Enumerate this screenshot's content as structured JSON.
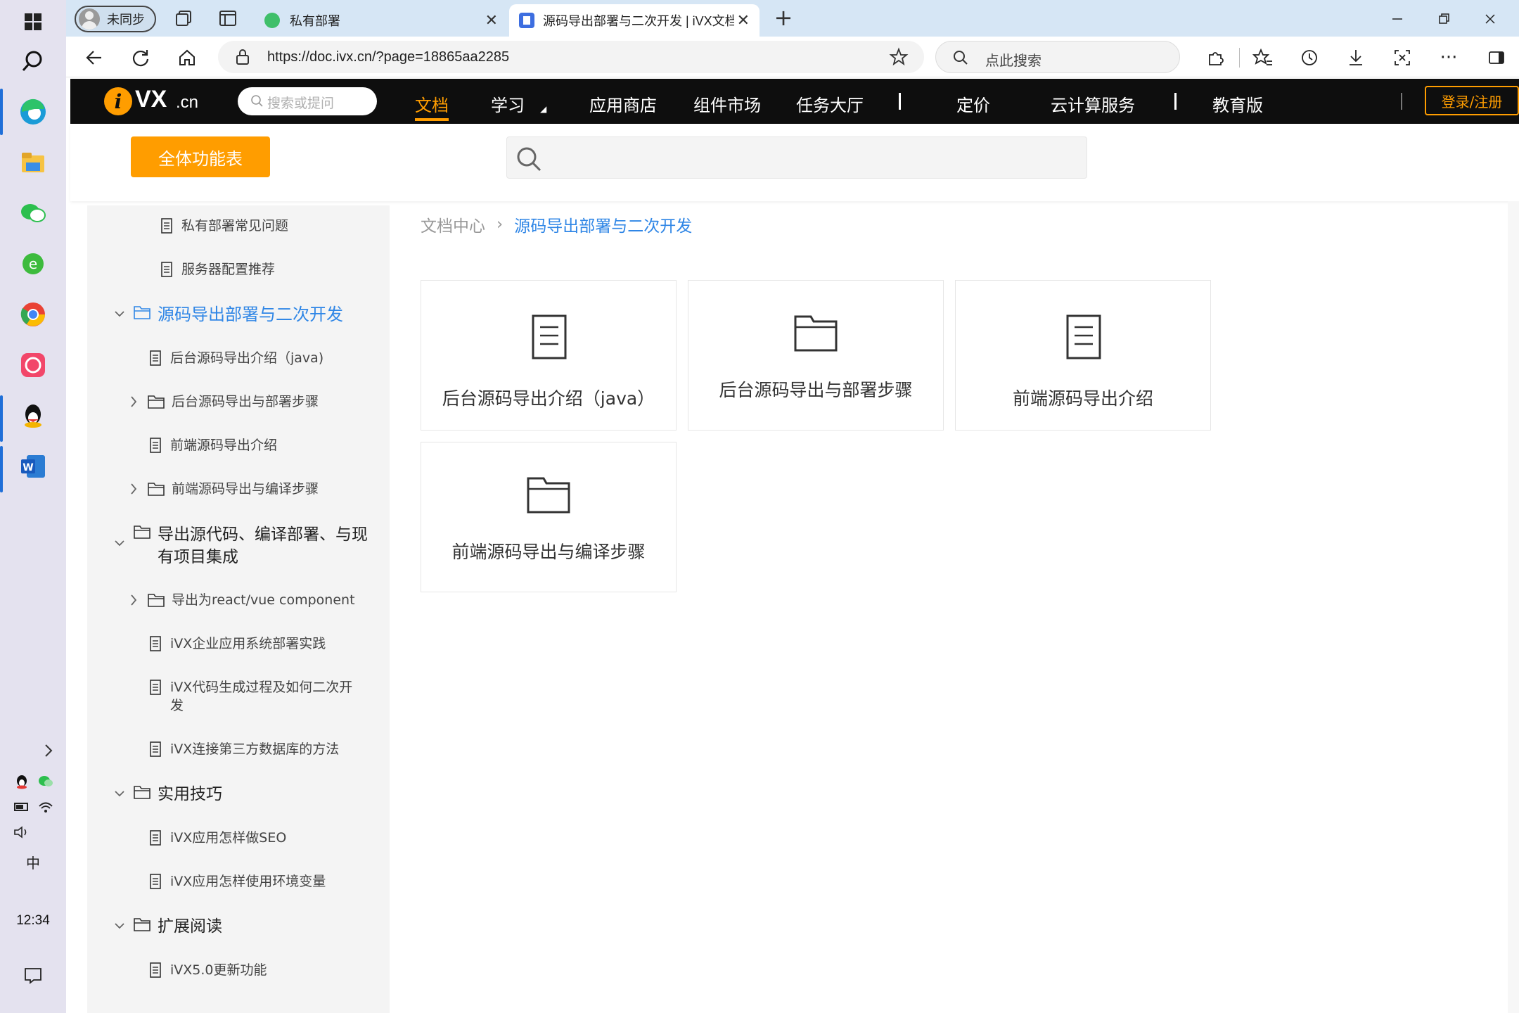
{
  "taskbar": {
    "clock": "12:34",
    "ime_label": "中"
  },
  "browser": {
    "profile_label": "未同步",
    "tabs": [
      {
        "title": "私有部署"
      },
      {
        "title": "源码导出部署与二次开发 | iVX文档"
      }
    ],
    "url": "https://doc.ivx.cn/?page=18865aa2285",
    "search_placeholder": "点此搜索"
  },
  "site": {
    "logo_text": "VX",
    "logo_suffix": ".cn",
    "search_placeholder": "搜索或提问",
    "nav": [
      "文档",
      "学习",
      "应用商店",
      "组件市场",
      "任务大厅",
      "定价",
      "云计算服务",
      "教育版"
    ],
    "login_label": "登录/注册",
    "all_features_label": "全体功能表"
  },
  "sidebar": {
    "items": [
      {
        "label": "私有部署常见问题"
      },
      {
        "label": "服务器配置推荐"
      },
      {
        "label": "源码导出部署与二次开发"
      },
      {
        "label": "后台源码导出介绍（java)"
      },
      {
        "label": "后台源码导出与部署步骤"
      },
      {
        "label": "前端源码导出介绍"
      },
      {
        "label": "前端源码导出与编译步骤"
      },
      {
        "label": "导出源代码、编译部署、与现有项目集成"
      },
      {
        "label": "导出为react/vue component"
      },
      {
        "label": "iVX企业应用系统部署实践"
      },
      {
        "label": "iVX代码生成过程及如何二次开发"
      },
      {
        "label": "iVX连接第三方数据库的方法"
      },
      {
        "label": "实用技巧"
      },
      {
        "label": "iVX应用怎样做SEO"
      },
      {
        "label": "iVX应用怎样使用环境变量"
      },
      {
        "label": "扩展阅读"
      },
      {
        "label": "iVX5.0更新功能"
      }
    ]
  },
  "breadcrumb": {
    "root": "文档中心",
    "separator": "›",
    "current": "源码导出部署与二次开发"
  },
  "cards": [
    {
      "title": "后台源码导出介绍（java）",
      "icon": "document-icon"
    },
    {
      "title": "后台源码导出与部署步骤",
      "icon": "folder-icon"
    },
    {
      "title": "前端源码导出介绍",
      "icon": "document-icon"
    },
    {
      "title": "前端源码导出与编译步骤",
      "icon": "folder-icon"
    }
  ],
  "colors": {
    "accent_orange": "#ff9d00",
    "link_blue": "#2f86e6",
    "nav_bg": "#0e0e0e"
  }
}
